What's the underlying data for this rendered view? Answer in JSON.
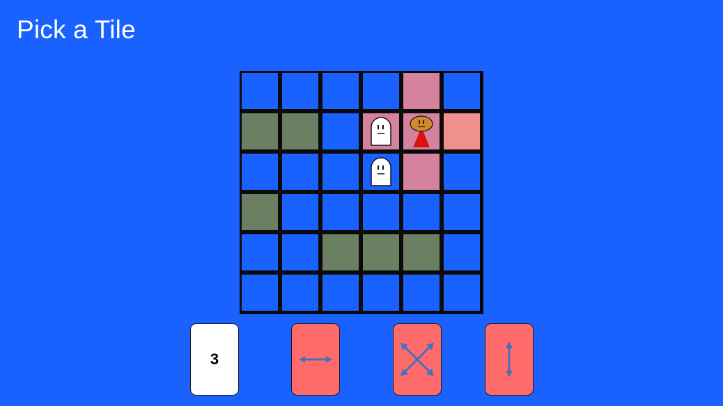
{
  "header": {
    "title": "Pick a Tile"
  },
  "board": {
    "rows": 6,
    "cols": 6,
    "cells": [
      [
        "empty",
        "empty",
        "empty",
        "empty",
        "pink",
        "empty"
      ],
      [
        "wall",
        "wall",
        "empty",
        "pink",
        "pink",
        "salmon"
      ],
      [
        "empty",
        "empty",
        "empty",
        "empty",
        "pink",
        "empty"
      ],
      [
        "wall",
        "empty",
        "empty",
        "empty",
        "empty",
        "empty"
      ],
      [
        "empty",
        "empty",
        "wall",
        "wall",
        "wall",
        "empty"
      ],
      [
        "empty",
        "empty",
        "empty",
        "empty",
        "empty",
        "empty"
      ]
    ],
    "pieces": [
      {
        "type": "ghost",
        "row": 1,
        "col": 3
      },
      {
        "type": "player",
        "row": 1,
        "col": 4
      },
      {
        "type": "ghost",
        "row": 2,
        "col": 3
      }
    ]
  },
  "hand": {
    "cards": [
      {
        "kind": "number",
        "label": "3",
        "color": "#ffffff"
      },
      {
        "kind": "move-horizontal",
        "icon": "horizontal-arrow-icon",
        "color": "#ff6b6b"
      },
      {
        "kind": "move-diagonal",
        "icon": "diagonal-arrows-icon",
        "color": "#ff6b6b"
      },
      {
        "kind": "move-vertical",
        "icon": "vertical-arrow-icon",
        "color": "#ff6b6b"
      }
    ]
  },
  "colors": {
    "background": "#1a62ff",
    "grid_line": "#0a0a0a",
    "wall": "#6b7f62",
    "pink_tile": "#d4829e",
    "salmon_tile": "#f0908c",
    "card_red": "#ff6b6b",
    "arrow": "#4a6fb8",
    "player_head": "#d4882e",
    "player_body": "#dd1111"
  }
}
